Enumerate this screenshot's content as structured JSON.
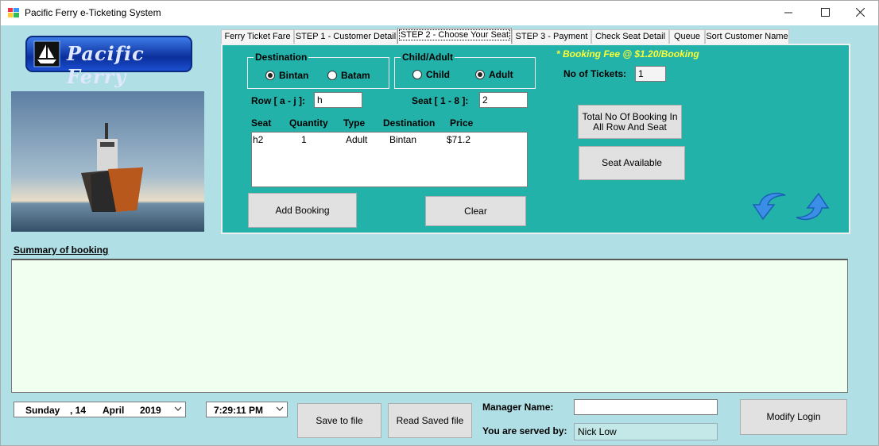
{
  "window": {
    "title": "Pacific Ferry e-Ticketing System"
  },
  "logo": {
    "text": "Pacific Ferry"
  },
  "tabs": [
    {
      "label": "Ferry Ticket Fare"
    },
    {
      "label": "STEP 1 - Customer Detail"
    },
    {
      "label": "STEP 2 - Choose Your Seat"
    },
    {
      "label": "STEP 3 - Payment"
    },
    {
      "label": "Check Seat Detail"
    },
    {
      "label": "Queue"
    },
    {
      "label": "Sort Customer Name"
    }
  ],
  "seat": {
    "destination": {
      "legend": "Destination",
      "options": [
        "Bintan",
        "Batam"
      ],
      "selected": "Bintan"
    },
    "passenger": {
      "legend": "Child/Adult",
      "options": [
        "Child",
        "Adult"
      ],
      "selected": "Adult"
    },
    "booking_fee": "* Booking Fee @ $1.20/Booking",
    "tickets_label": "No of Tickets:",
    "tickets_value": "1",
    "row_label": "Row [ a - j ]:",
    "row_value": "h",
    "seat_label": "Seat [ 1 - 8 ]:",
    "seat_value": "2",
    "list_headers": [
      "Seat",
      "Quantity",
      "Type",
      "Destination",
      "Price"
    ],
    "list_rows": [
      [
        "h2",
        "1",
        "Adult",
        "Bintan",
        "$71.2"
      ]
    ],
    "add_booking": "Add Booking",
    "clear": "Clear",
    "total_booking_line1": "Total No Of Booking In",
    "total_booking_line2": "All Row And Seat",
    "seat_available": "Seat Available"
  },
  "summary": {
    "label": "Summary of booking"
  },
  "footer": {
    "date_day": "Sunday",
    "date_date": ", 14",
    "date_month": "April",
    "date_year": "2019",
    "time": "7:29:11 PM",
    "save_to_file": "Save to file",
    "read_saved_file": "Read Saved file",
    "manager_label": "Manager Name:",
    "manager_value": "",
    "served_label": "You are served by:",
    "served_value": "Nick Low",
    "modify_login": "Modify Login"
  },
  "colors": {
    "panel": "#22b2aa",
    "window_bg": "#b0dfe5",
    "fee_text": "#ffff33",
    "summary_bg": "#f0fff0"
  }
}
